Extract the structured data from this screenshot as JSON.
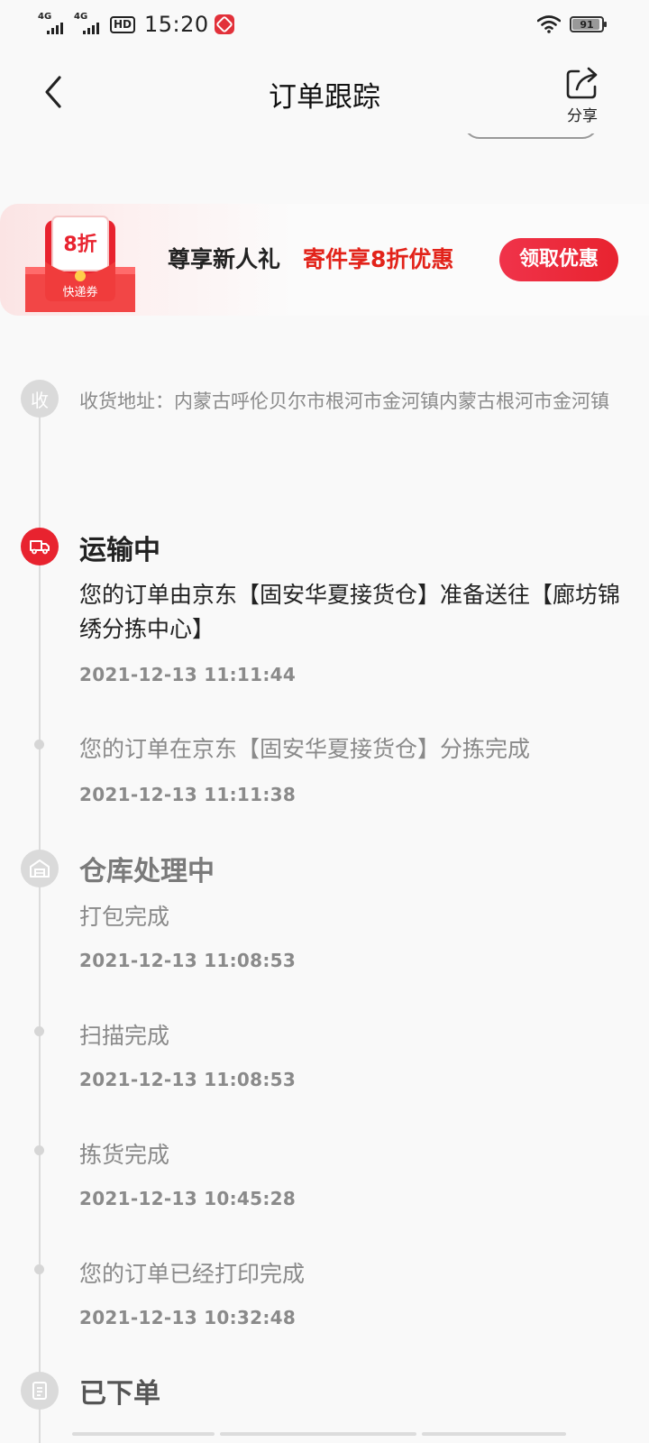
{
  "status_bar": {
    "network_1": "4G",
    "network_2": "4G",
    "hd_badge": "HD",
    "time": "15:20",
    "battery_level": "91",
    "icons": [
      "signal-icon",
      "hd-icon",
      "app-notification-icon",
      "wifi-icon",
      "battery-icon"
    ]
  },
  "header": {
    "title": "订单跟踪",
    "share_label": "分享",
    "back_icon": "back-arrow-icon",
    "share_icon": "share-icon"
  },
  "promo": {
    "coupon_discount": "8折",
    "coupon_label": "快递券",
    "text": "尊享新人礼",
    "highlight": "寄件享8折优惠",
    "button": "领取优惠",
    "colors": {
      "accent": "#e8232f"
    }
  },
  "timeline": {
    "address_node_char": "收",
    "address": "收货地址：内蒙古呼伦贝尔市根河市金河镇内蒙古根河市金河镇",
    "sections": [
      {
        "status": "运输中",
        "icon": "truck-icon",
        "active": true,
        "events": [
          {
            "text": "您的订单由京东【固安华夏接货仓】准备送往【廊坊锦绣分拣中心】",
            "time": "2021-12-13 11:11:44"
          },
          {
            "text": "您的订单在京东【固安华夏接货仓】分拣完成",
            "time": "2021-12-13 11:11:38"
          }
        ]
      },
      {
        "status": "仓库处理中",
        "icon": "warehouse-icon",
        "active": false,
        "events": [
          {
            "text": "打包完成",
            "time": "2021-12-13 11:08:53"
          },
          {
            "text": "扫描完成",
            "time": "2021-12-13 11:08:53"
          },
          {
            "text": "拣货完成",
            "time": "2021-12-13 10:45:28"
          },
          {
            "text": "您的订单已经打印完成",
            "time": "2021-12-13 10:32:48"
          }
        ]
      },
      {
        "status": "已下单",
        "icon": "order-icon",
        "active": false,
        "events": []
      }
    ]
  }
}
